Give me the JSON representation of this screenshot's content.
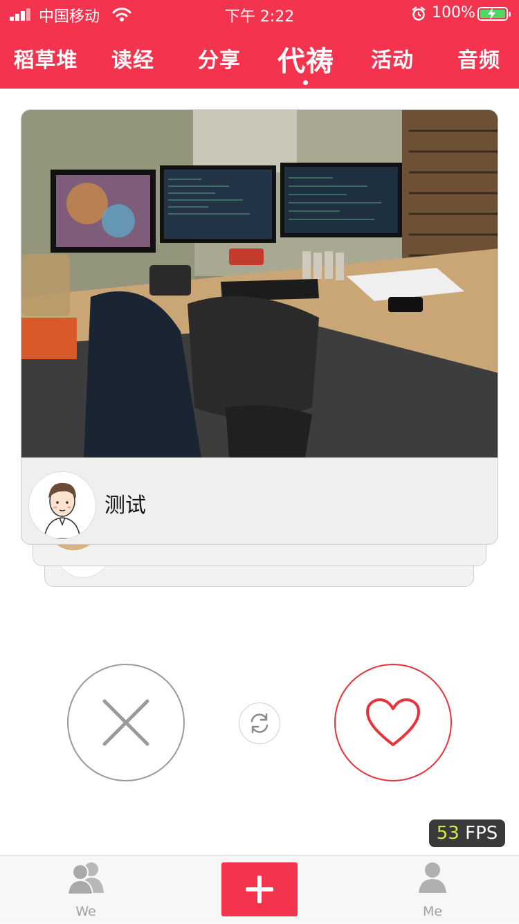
{
  "status_bar": {
    "carrier": "中国移动",
    "time": "下午 2:22",
    "battery": "100%"
  },
  "nav": {
    "tabs": [
      "稻草堆",
      "读经",
      "分享",
      "代祷",
      "活动",
      "音频"
    ],
    "active_tab": "代祷"
  },
  "card": {
    "name": "测试"
  },
  "actions": {
    "dislike_icon": "close-icon",
    "refresh_icon": "refresh-icon",
    "like_icon": "heart-icon"
  },
  "fps": {
    "value": "53",
    "unit": "FPS"
  },
  "tab_bar": {
    "left_label": "We",
    "right_label": "Me",
    "center_icon": "plus-icon"
  },
  "colors": {
    "brand": "#f4344f",
    "like": "#e8323a",
    "dislike": "#9a9a9a"
  }
}
